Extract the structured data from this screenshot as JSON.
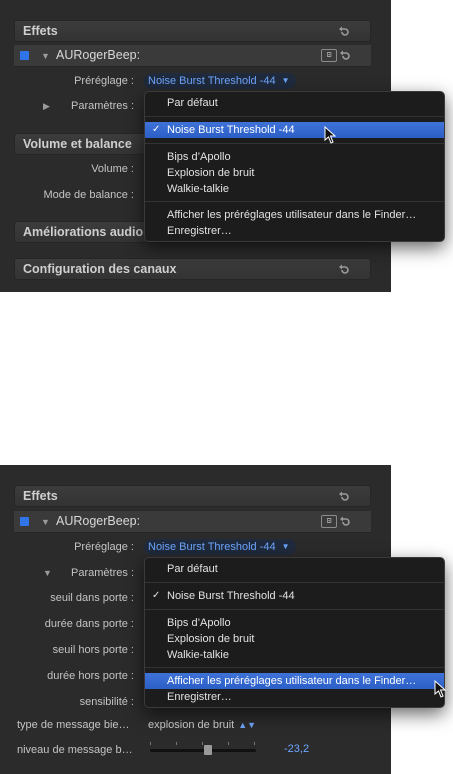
{
  "screen1": {
    "effects_header": "Effets",
    "effect_name": "AURogerBeep:",
    "preset_label": "Préréglage :",
    "preset_value": "Noise Burst Threshold -44",
    "params_label": "Paramètres :",
    "volume_header": "Volume et balance",
    "volume_label": "Volume :",
    "pan_label": "Mode de balance :",
    "audio_enh_header": "Améliorations audio",
    "channels_header": "Configuration des canaux",
    "menu": {
      "default": "Par défaut",
      "selected": "Noise Burst Threshold -44",
      "items": [
        "Bips d’Apollo",
        "Explosion de bruit",
        "Walkie-talkie"
      ],
      "show_in_finder": "Afficher les préréglages utilisateur dans le Finder…",
      "save": "Enregistrer…"
    }
  },
  "screen2": {
    "effects_header": "Effets",
    "effect_name": "AURogerBeep:",
    "preset_label": "Préréglage :",
    "preset_value": "Noise Burst Threshold -44",
    "params_label": "Paramètres :",
    "param_labels": [
      "seuil dans porte :",
      "durée dans porte :",
      "seuil hors porte :",
      "durée hors porte :",
      "sensibilité :"
    ],
    "type_label": "type de message bie…",
    "type_value": "explosion de bruit",
    "level_label": "niveau de message b…",
    "level_value": "-23,2",
    "level_fraction": 0.55,
    "menu": {
      "default": "Par défaut",
      "checked": "Noise Burst Threshold -44",
      "items": [
        "Bips d’Apollo",
        "Explosion de bruit",
        "Walkie-talkie"
      ],
      "show_in_finder": "Afficher les préréglages utilisateur dans le Finder…",
      "save": "Enregistrer…"
    }
  },
  "icons": {
    "reset": "reset-icon",
    "plugin_ui": "plugin-ui-icon",
    "cursor": "cursor-icon",
    "enable": "enable-checkbox-icon"
  },
  "colors": {
    "accent": "#2f74e8",
    "popup_text": "#6ea6ff",
    "selected_bg": "#3f73d8",
    "panel_bg": "#2b2b2b"
  }
}
